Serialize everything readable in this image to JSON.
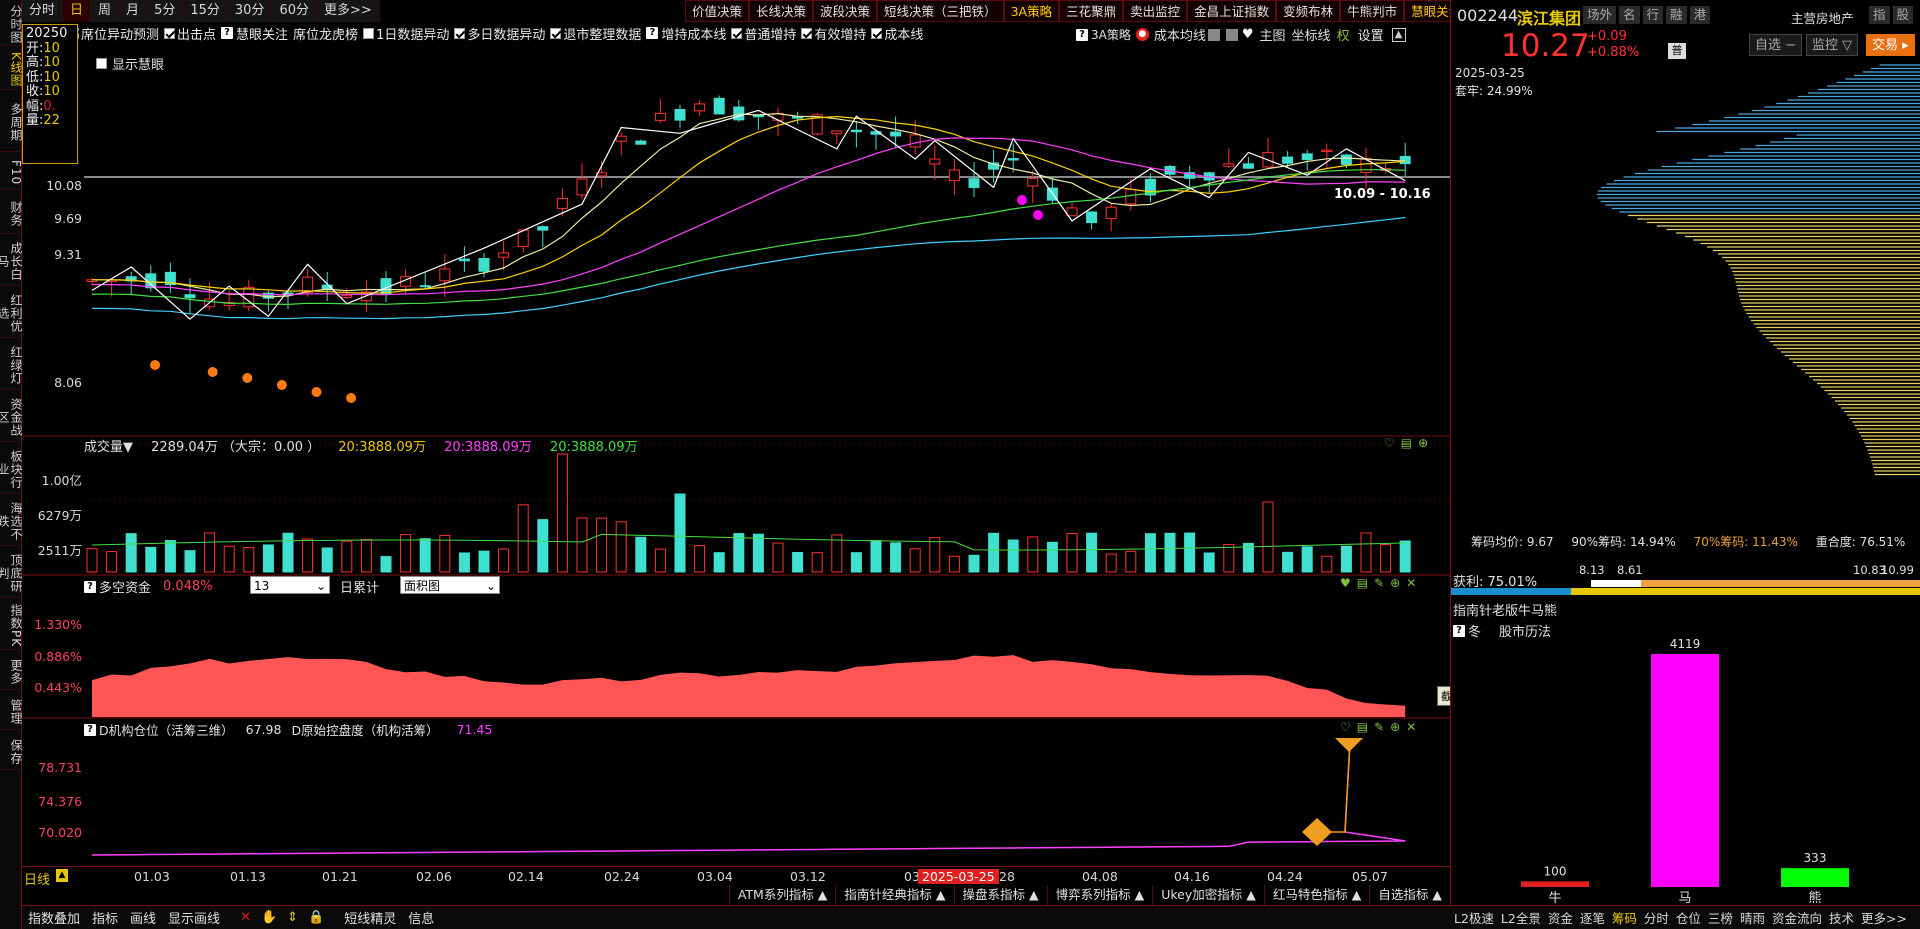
{
  "left_nav": [
    "分时图",
    "K线图",
    "多周期",
    "F10",
    "财务",
    "成长白马",
    "红利优选",
    "红绿灯",
    "资金战区",
    "板块行业",
    "海选不跌",
    "顶底研判",
    "指数PK",
    "更多",
    "管理",
    "保存"
  ],
  "periods": [
    "分时",
    "日",
    "周",
    "月",
    "5分",
    "15分",
    "30分",
    "60分",
    "更多>>"
  ],
  "tools": [
    "价值决策",
    "长线决策",
    "波段决策",
    "短线决策（三把铁）",
    "3A策略",
    "三花聚鼎",
    "卖出监控",
    "金昌上证指数",
    "变频布林",
    "牛熊判市",
    "慧眼关注"
  ],
  "checkboxes": [
    {
      "label": "席位异动预测",
      "checked": true
    },
    {
      "label": "出击点",
      "checked": true
    },
    {
      "label": "慧眼关注",
      "checked": false,
      "q": true
    },
    {
      "label": "席位龙虎榜",
      "checked": false,
      "plain": true
    },
    {
      "label": "1日数据异动",
      "checked": false
    },
    {
      "label": "多日数据异动",
      "checked": true
    },
    {
      "label": "退市整理数据",
      "checked": true
    },
    {
      "label": "增持成本线",
      "checked": false,
      "q": true
    },
    {
      "label": "普通增持",
      "checked": true
    },
    {
      "label": "有效增持",
      "checked": true
    },
    {
      "label": "成本线",
      "checked": true
    }
  ],
  "toprow_right": {
    "strategy": "3A策略",
    "cost_ma": "成本均线",
    "main": "主图",
    "coord": "坐标线",
    "quan": "权",
    "settings": "设置"
  },
  "show_huiyan": "显示慧眼",
  "infobox": {
    "date": "20250",
    "open_l": "开:",
    "open": "10",
    "high_l": "高:",
    "high": "10",
    "low_l": "低:",
    "low": "10",
    "close_l": "收:",
    "close": "10",
    "amp_l": "幅:",
    "amp": "0.",
    "vol_l": "量:",
    "vol": "22"
  },
  "price_axis": [
    "10.08",
    "9.69",
    "9.31",
    "8.06"
  ],
  "price_range_label": "10.09 - 10.16",
  "volume": {
    "title": "成交量▼",
    "value": "2289.04万",
    "big": "（大宗：0.00 ）",
    "ma1": "20:3888.09万",
    "ma2": "20:3888.09万",
    "ma3": "20:3888.09万",
    "axis": [
      "1.00亿",
      "6279万",
      "2511万"
    ]
  },
  "fund": {
    "title": "多空资金",
    "value": "0.048%",
    "select1": "13",
    "label2": "日累计",
    "select2": "面积图",
    "axis": [
      "1.330%",
      "0.886%",
      "0.443%"
    ]
  },
  "inst": {
    "title": "D机构仓位（活筹三维）",
    "v1": "67.98",
    "title2": "D原始控盘度（机构活筹）",
    "v2": "71.45",
    "axis": [
      "78.731",
      "74.376",
      "70.020"
    ]
  },
  "date_axis": {
    "period": "日线",
    "labels": [
      "01.03",
      "01.13",
      "01.21",
      "02.06",
      "02.14",
      "02.24",
      "03.04",
      "03.12",
      "03.",
      "2025-03-25",
      "28",
      "04.08",
      "04.16",
      "04.24",
      "05.07"
    ]
  },
  "screenshot_tip": "截图(Alt + A)",
  "sysbar": [
    "ATM系列指标 ▲",
    "指南针经典指标 ▲",
    "操盘系指标 ▲",
    "博弈系列指标 ▲",
    "Ukey加密指标 ▲",
    "红马特色指标 ▲",
    "自选指标 ▲"
  ],
  "bottombar": [
    "指数叠加",
    "指标",
    "画线",
    "显示画线",
    "短线精灵",
    "信息"
  ],
  "stock": {
    "code": "002244",
    "name": "滨江集团",
    "tags": [
      "场外",
      "名",
      "行",
      "融",
      "港"
    ],
    "industry": "主营房地产",
    "right_tags": [
      "指",
      "股"
    ],
    "price": "10.27",
    "change": "+0.09",
    "pct": "+0.88%",
    "pu": "普",
    "zixuan": "自选 −",
    "jiankong": "监控 ▽",
    "trade": "交易 ▸"
  },
  "chip": {
    "date": "2025-03-25",
    "lock": "套牢: 24.99%",
    "avg_l": "筹码均价:",
    "avg": "9.67",
    "p90_l": "90%筹码:",
    "p90": "14.94%",
    "p70_l": "70%筹码:",
    "p70": "11.43%",
    "overlap_l": "重合度:",
    "overlap": "76.51%",
    "profit": "获利: 75.01%",
    "scale": [
      "8.13",
      "8.61",
      "10.83",
      "10.99"
    ]
  },
  "bull": {
    "title": "指南针老版牛马熊",
    "season": "冬",
    "history": "股市历法",
    "bars": [
      {
        "name": "牛",
        "value": 100,
        "color": "#e02020"
      },
      {
        "name": "马",
        "value": 4119,
        "color": "#ff00ff"
      },
      {
        "name": "熊",
        "value": 333,
        "color": "#00ff00"
      }
    ]
  },
  "rbottom": [
    "L2极速",
    "L2全景",
    "资金",
    "逐笔",
    "筹码",
    "分时",
    "仓位",
    "三榜",
    "晴雨",
    "资金流向",
    "技术",
    "更多>>"
  ]
}
